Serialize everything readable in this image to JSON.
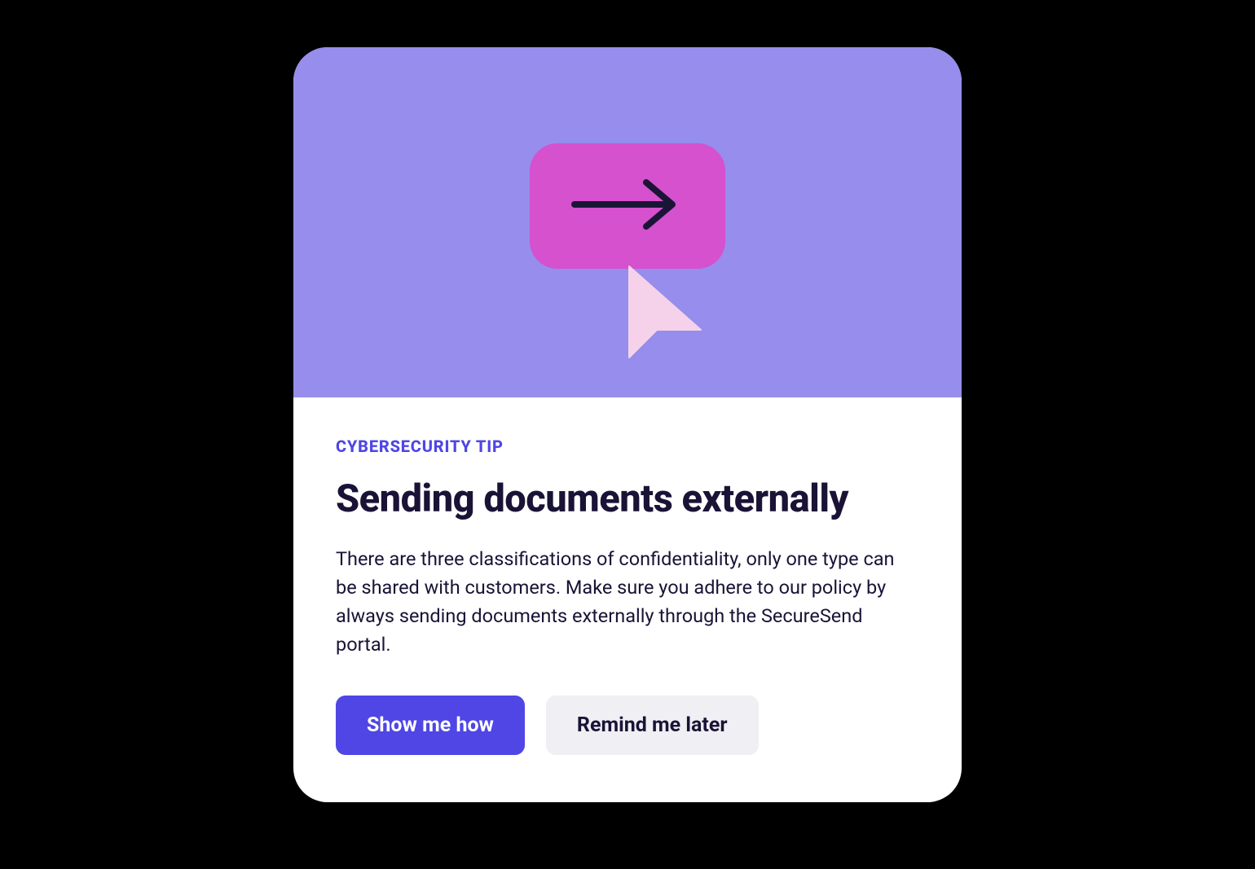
{
  "card": {
    "eyebrow": "CYBERSECURITY TIP",
    "title": "Sending documents externally",
    "body": "There are three classifications of confidentiality, only one type can be shared with customers. Make sure you adhere to our policy by always sending documents externally through the SecureSend portal.",
    "primary_button": "Show me how",
    "secondary_button": "Remind me later"
  },
  "colors": {
    "hero_bg": "#968ded",
    "hero_button_bg": "#d551cd",
    "cursor_fill": "#f6d2ea",
    "accent": "#4f46e5",
    "text": "#1a1336",
    "secondary_btn_bg": "#f0eff4"
  },
  "icons": {
    "hero_arrow": "arrow-right-icon",
    "hero_cursor": "cursor-icon"
  }
}
